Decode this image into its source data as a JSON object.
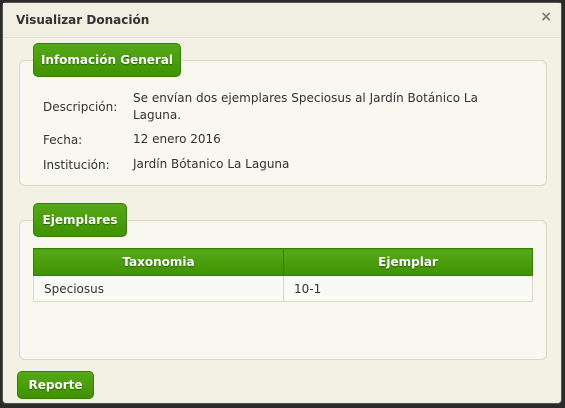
{
  "dialog": {
    "title": "Visualizar Donación",
    "close_icon": "×"
  },
  "general": {
    "legend": "Infomación General",
    "description_label": "Descripción:",
    "description_value": "Se envían dos ejemplares Speciosus al Jardín Botánico La Laguna.",
    "date_label": "Fecha:",
    "date_value": "12 enero 2016",
    "institution_label": "Institución:",
    "institution_value": "Jardín Bótanico La Laguna"
  },
  "specimens": {
    "legend": "Ejemplares",
    "columns": [
      "Taxonomia",
      "Ejemplar"
    ],
    "rows": [
      [
        "Speciosus",
        "10-1"
      ]
    ]
  },
  "actions": {
    "report_label": "Reporte"
  },
  "colors": {
    "accent": "#4a9c0c"
  }
}
